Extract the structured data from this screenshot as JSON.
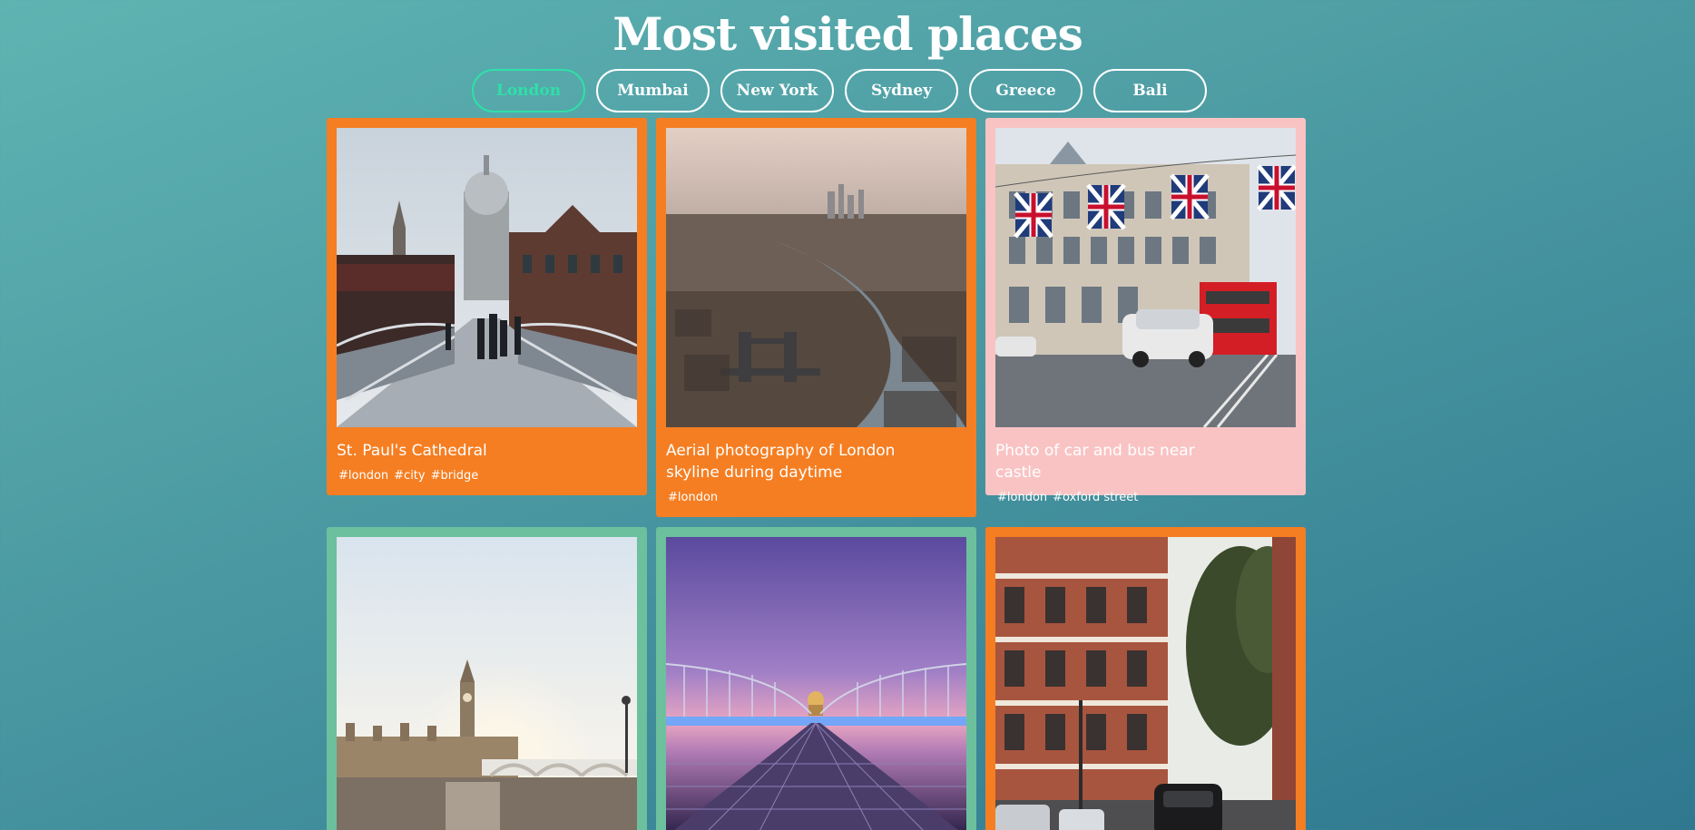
{
  "header": {
    "title": "Most visited places"
  },
  "filters": [
    {
      "label": "London",
      "active": true
    },
    {
      "label": "Mumbai",
      "active": false
    },
    {
      "label": "New York",
      "active": false
    },
    {
      "label": "Sydney",
      "active": false
    },
    {
      "label": "Greece",
      "active": false
    },
    {
      "label": "Bali",
      "active": false
    }
  ],
  "colors": {
    "accent_active": "#2fe0a8",
    "card_orange": "#f57e22",
    "card_pink": "#f9c3c4",
    "card_green": "#6cc09e"
  },
  "cards": [
    {
      "title": "St. Paul's Cathedral",
      "tags": [
        "#london",
        "#city",
        "#bridge"
      ],
      "color": "orange"
    },
    {
      "title": "Aerial photography of London skyline during daytime",
      "tags": [
        "#london"
      ],
      "color": "orange"
    },
    {
      "title": "Photo of car and bus near castle",
      "tags": [
        "#london",
        "#oxford street"
      ],
      "color": "pink"
    },
    {
      "title": "",
      "tags": [],
      "color": "green"
    },
    {
      "title": "",
      "tags": [],
      "color": "green"
    },
    {
      "title": "",
      "tags": [],
      "color": "orange"
    }
  ]
}
